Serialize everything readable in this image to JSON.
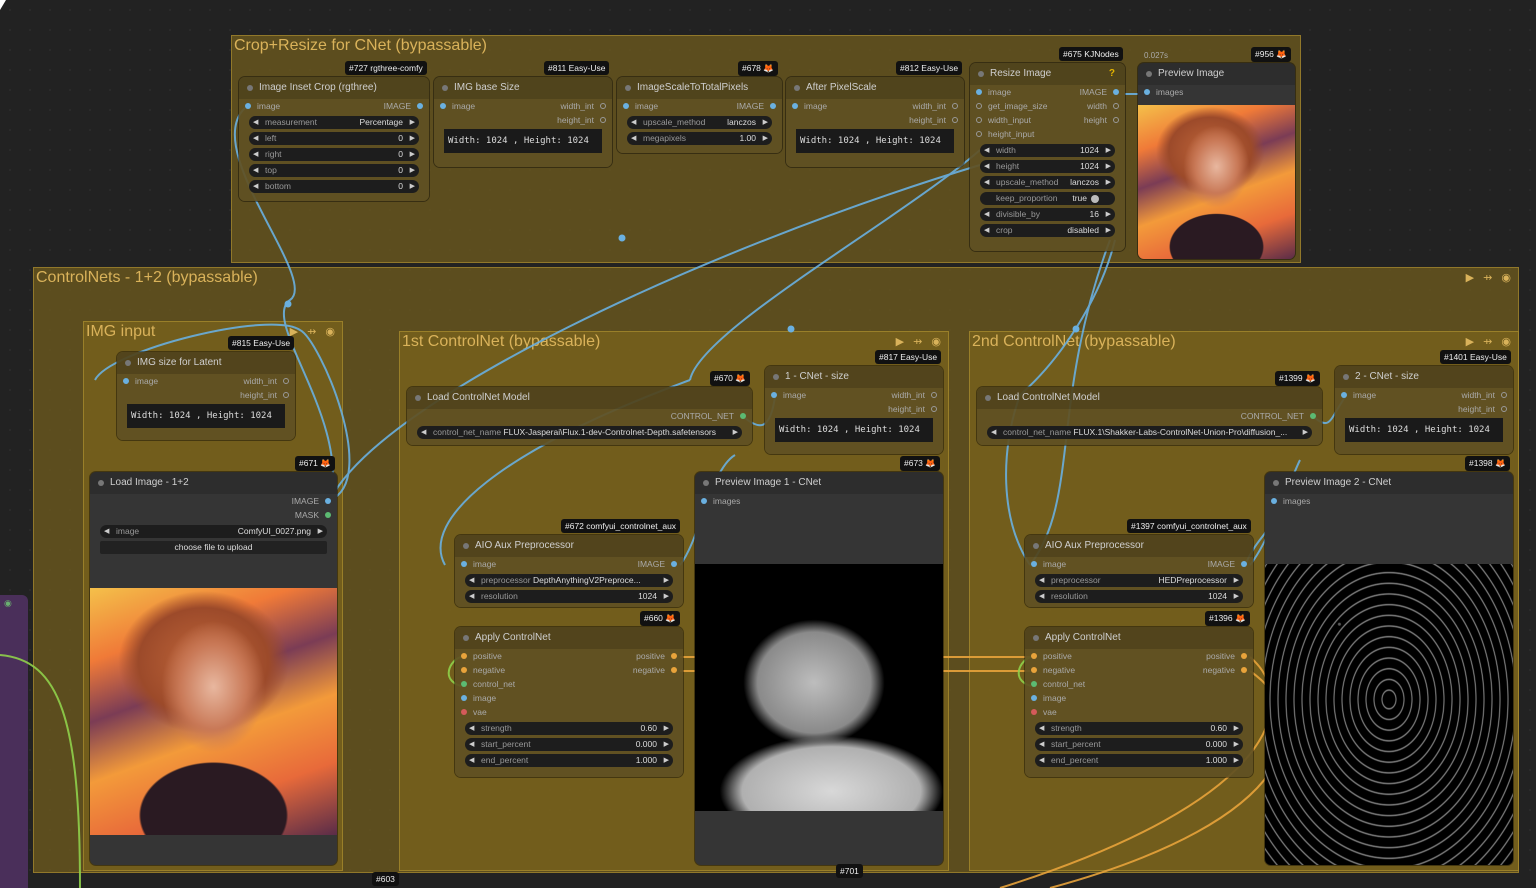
{
  "groups": {
    "crop": {
      "title": "Crop+Resize for CNet (bypassable)"
    },
    "controlnets": {
      "title": "ControlNets - 1+2 (bypassable)"
    },
    "img_input": {
      "title": "IMG input"
    },
    "cnet1": {
      "title": "1st ControlNet (bypassable)"
    },
    "cnet2": {
      "title": "2nd ControlNet (bypassable)"
    },
    "controls": "▶ ⇸ ◉"
  },
  "badges": {
    "b727": "#727 rgthree-comfy",
    "b811": "#811 Easy-Use",
    "b678": "#678 🦊",
    "b812": "#812 Easy-Use",
    "b675": "#675 KJNodes",
    "b956": "#956 🦊",
    "timing": "0.027s",
    "b815": "#815 Easy-Use",
    "b671": "#671 🦊",
    "b670": "#670 🦊",
    "b817": "#817 Easy-Use",
    "b673": "#673 🦊",
    "b672": "#672 comfyui_controlnet_aux",
    "b660": "#660 🦊",
    "b1399": "#1399 🦊",
    "b1401": "#1401 Easy-Use",
    "b1398": "#1398 🦊",
    "b1397": "#1397 comfyui_controlnet_aux",
    "b1396": "#1396 🦊",
    "b603": "#603",
    "b701": "#701"
  },
  "nodes": {
    "inset_crop": {
      "title": "Image Inset Crop (rgthree)",
      "in_image": "image",
      "out_image": "IMAGE",
      "widgets": [
        {
          "label": "measurement",
          "value": "Percentage"
        },
        {
          "label": "left",
          "value": "0"
        },
        {
          "label": "right",
          "value": "0"
        },
        {
          "label": "top",
          "value": "0"
        },
        {
          "label": "bottom",
          "value": "0"
        }
      ]
    },
    "img_base_size": {
      "title": "IMG base Size",
      "in_image": "image",
      "out_w": "width_int",
      "out_h": "height_int",
      "text": "Width: 1024 , Height: 1024"
    },
    "scale_total": {
      "title": "ImageScaleToTotalPixels",
      "in_image": "image",
      "out_image": "IMAGE",
      "widgets": [
        {
          "label": "upscale_method",
          "value": "lanczos"
        },
        {
          "label": "megapixels",
          "value": "1.00"
        }
      ]
    },
    "after_pixelscale": {
      "title": "After PixelScale",
      "in_image": "image",
      "out_w": "width_int",
      "out_h": "height_int",
      "text": "Width: 1024 , Height: 1024"
    },
    "resize_image": {
      "title": "Resize Image",
      "help": "?",
      "in_image": "image",
      "in_get": "get_image_size",
      "in_w": "width_input",
      "in_h": "height_input",
      "out_image": "IMAGE",
      "out_w": "width",
      "out_h": "height",
      "widgets": [
        {
          "label": "width",
          "value": "1024"
        },
        {
          "label": "height",
          "value": "1024"
        },
        {
          "label": "upscale_method",
          "value": "lanczos"
        }
      ],
      "toggle": {
        "label": "keep_proportion",
        "value": "true"
      },
      "widgets2": [
        {
          "label": "divisible_by",
          "value": "16"
        },
        {
          "label": "crop",
          "value": "disabled"
        }
      ]
    },
    "preview_image": {
      "title": "Preview Image",
      "in_images": "images"
    },
    "img_size_latent": {
      "title": "IMG size for Latent",
      "in_image": "image",
      "out_w": "width_int",
      "out_h": "height_int",
      "text": "Width: 1024 , Height: 1024"
    },
    "load_image": {
      "title": "Load Image - 1+2",
      "out_image": "IMAGE",
      "out_mask": "MASK",
      "widget": {
        "label": "image",
        "value": "ComfyUI_0027.png"
      },
      "upload": "choose file to upload"
    },
    "load_cn1": {
      "title": "Load ControlNet Model",
      "out": "CONTROL_NET",
      "widget": {
        "label": "control_net_name",
        "value": "FLUX-Jasperai\\Flux.1-dev-Controlnet-Depth.safetensors"
      }
    },
    "cnet_size1": {
      "title": "1 - CNet - size",
      "in_image": "image",
      "out_w": "width_int",
      "out_h": "height_int",
      "text": "Width: 1024 , Height: 1024"
    },
    "preview_cn1": {
      "title": "Preview Image 1 - CNet",
      "in_images": "images"
    },
    "aio1": {
      "title": "AIO Aux Preprocessor",
      "in_image": "image",
      "out_image": "IMAGE",
      "widgets": [
        {
          "label": "preprocessor",
          "value": "DepthAnythingV2Preproce..."
        },
        {
          "label": "resolution",
          "value": "1024"
        }
      ]
    },
    "apply1": {
      "title": "Apply ControlNet",
      "in_pos": "positive",
      "in_neg": "negative",
      "in_cn": "control_net",
      "in_image": "image",
      "in_vae": "vae",
      "out_pos": "positive",
      "out_neg": "negative",
      "widgets": [
        {
          "label": "strength",
          "value": "0.60"
        },
        {
          "label": "start_percent",
          "value": "0.000"
        },
        {
          "label": "end_percent",
          "value": "1.000"
        }
      ]
    },
    "load_cn2": {
      "title": "Load ControlNet Model",
      "out": "CONTROL_NET",
      "widget": {
        "label": "control_net_name",
        "value": "FLUX.1\\Shakker-Labs-ControlNet-Union-Pro\\diffusion_..."
      }
    },
    "cnet_size2": {
      "title": "2 - CNet - size",
      "in_image": "image",
      "out_w": "width_int",
      "out_h": "height_int",
      "text": "Width: 1024 , Height: 1024"
    },
    "preview_cn2": {
      "title": "Preview Image 2 - CNet",
      "in_images": "images"
    },
    "aio2": {
      "title": "AIO Aux Preprocessor",
      "in_image": "image",
      "out_image": "IMAGE",
      "widgets": [
        {
          "label": "preprocessor",
          "value": "HEDPreprocessor"
        },
        {
          "label": "resolution",
          "value": "1024"
        }
      ]
    },
    "apply2": {
      "title": "Apply ControlNet",
      "in_pos": "positive",
      "in_neg": "negative",
      "in_cn": "control_net",
      "in_image": "image",
      "in_vae": "vae",
      "out_pos": "positive",
      "out_neg": "negative",
      "widgets": [
        {
          "label": "strength",
          "value": "0.60"
        },
        {
          "label": "start_percent",
          "value": "0.000"
        },
        {
          "label": "end_percent",
          "value": "1.000"
        }
      ]
    }
  }
}
